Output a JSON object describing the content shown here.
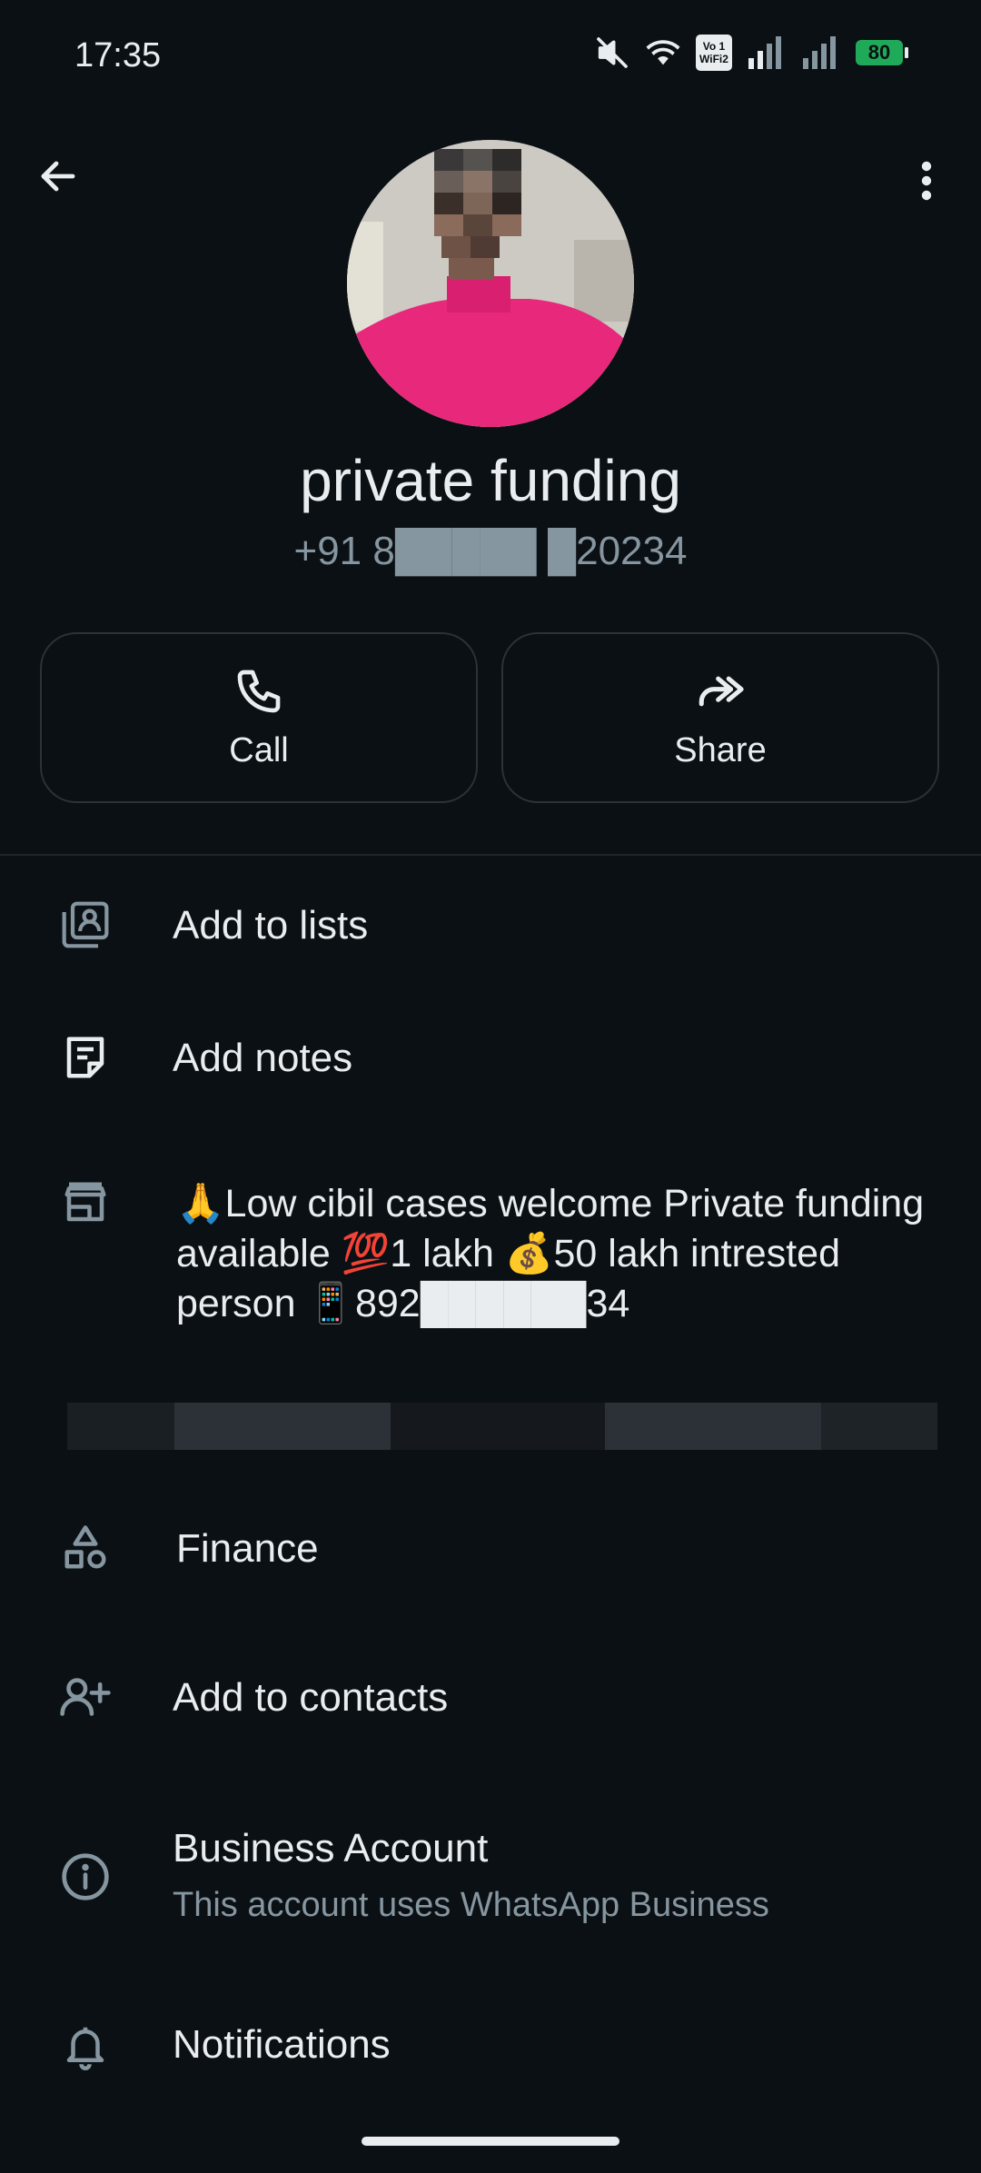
{
  "status_bar": {
    "time": "17:35",
    "volte_top": "Vo 1",
    "volte_bottom": "WiFi2",
    "battery": "80"
  },
  "header": {
    "back_icon": "arrow-left-icon",
    "menu_icon": "more-vertical-icon"
  },
  "contact": {
    "name": "private funding",
    "phone": "+91 8█████ █20234"
  },
  "actions": {
    "call_label": "Call",
    "share_label": "Share"
  },
  "rows": {
    "add_to_lists": "Add to lists",
    "add_notes": "Add notes",
    "about": "🙏Low cibil cases welcome Private funding available 💯1 lakh 💰50 lakh intrested person 📱892██████34",
    "category": "Finance",
    "add_to_contacts": "Add to contacts",
    "business_account_title": "Business Account",
    "business_account_sub": "This account uses WhatsApp Business",
    "notifications": "Notifications"
  },
  "colors": {
    "background": "#0b1014",
    "text_primary": "#e9edef",
    "text_secondary": "#8696a0",
    "battery_green": "#1faa59"
  }
}
